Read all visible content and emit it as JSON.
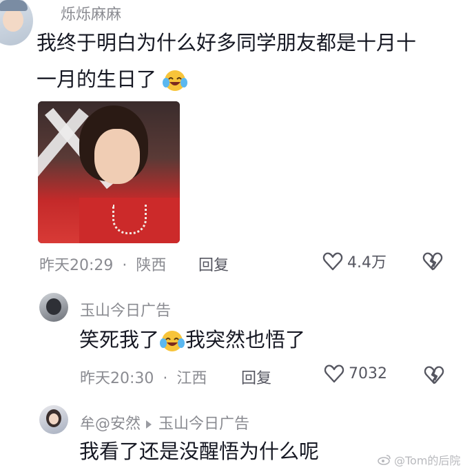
{
  "comments": [
    {
      "username": "烁烁麻麻",
      "text_line1": "我终于明白为什么好多同学朋友都是十月十",
      "text_line2": "一月的生日了",
      "emoji": "laugh-cry-emoji",
      "time": "昨天20:29",
      "location": "陕西",
      "reply_label": "回复",
      "likes": "4.4万"
    },
    {
      "username": "玉山今日广告",
      "text_a": "笑死我了",
      "text_b": "我突然也悟了",
      "emoji": "laugh-cry-emoji",
      "time": "昨天20:30",
      "location": "江西",
      "reply_label": "回复",
      "likes": "7032"
    },
    {
      "username": "牟@安然",
      "reply_to": "玉山今日广告",
      "text": "我看了还是没醒悟为什么呢"
    }
  ],
  "separator": "·",
  "watermark": "@Tom的后院",
  "colors": {
    "meta": "#8a8b91",
    "text": "#161823",
    "image_bg": "#b03030"
  }
}
